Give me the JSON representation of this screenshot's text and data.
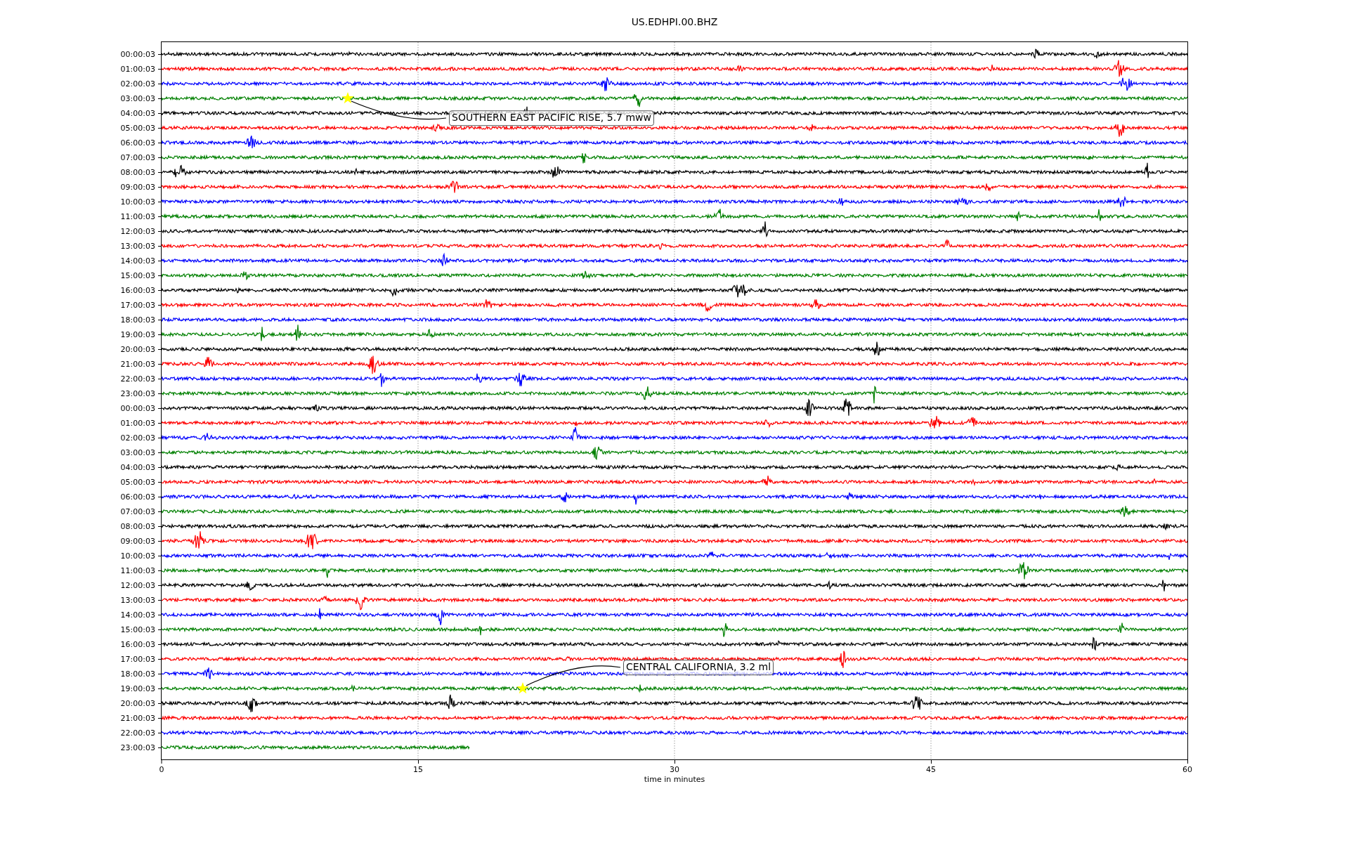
{
  "title": "US.EDHPI.00.BHZ",
  "traces": [
    {
      "label": "00:00:03",
      "color": "#000000",
      "level": 1
    },
    {
      "label": "01:00:03",
      "color": "#ff0000",
      "level": 1
    },
    {
      "label": "02:00:03",
      "color": "#0000ff",
      "level": 1
    },
    {
      "label": "03:00:03",
      "color": "#008000",
      "level": 1,
      "event": "SOUTHERN EAST PACIFIC RISE, 5.7 mww"
    },
    {
      "label": "04:00:03",
      "color": "#000000",
      "level": 1
    },
    {
      "label": "05:00:03",
      "color": "#ff0000",
      "level": 1
    },
    {
      "label": "06:00:03",
      "color": "#0000ff",
      "level": 1
    },
    {
      "label": "07:00:03",
      "color": "#008000",
      "level": 1
    },
    {
      "label": "08:00:03",
      "color": "#000000",
      "level": 1
    },
    {
      "label": "09:00:03",
      "color": "#ff0000",
      "level": 1
    },
    {
      "label": "10:00:03",
      "color": "#0000ff",
      "level": 1
    },
    {
      "label": "11:00:03",
      "color": "#008000",
      "level": 1
    },
    {
      "label": "12:00:03",
      "color": "#000000",
      "level": 1
    },
    {
      "label": "13:00:03",
      "color": "#ff0000",
      "level": 1
    },
    {
      "label": "14:00:03",
      "color": "#0000ff",
      "level": 1
    },
    {
      "label": "15:00:03",
      "color": "#008000",
      "level": 1
    },
    {
      "label": "16:00:03",
      "color": "#000000",
      "level": 1
    },
    {
      "label": "17:00:03",
      "color": "#ff0000",
      "level": 1
    },
    {
      "label": "18:00:03",
      "color": "#0000ff",
      "level": 1
    },
    {
      "label": "19:00:03",
      "color": "#008000",
      "level": 1
    },
    {
      "label": "20:00:03",
      "color": "#000000",
      "level": 1
    },
    {
      "label": "21:00:03",
      "color": "#ff0000",
      "level": 1
    },
    {
      "label": "22:00:03",
      "color": "#0000ff",
      "level": 1
    },
    {
      "label": "23:00:03",
      "color": "#008000",
      "level": 1
    },
    {
      "label": "00:00:03",
      "color": "#000000",
      "level": 1
    },
    {
      "label": "01:00:03",
      "color": "#ff0000",
      "level": 1
    },
    {
      "label": "02:00:03",
      "color": "#0000ff",
      "level": 1
    },
    {
      "label": "03:00:03",
      "color": "#008000",
      "level": 1
    },
    {
      "label": "04:00:03",
      "color": "#000000",
      "level": 1
    },
    {
      "label": "05:00:03",
      "color": "#ff0000",
      "level": 1
    },
    {
      "label": "06:00:03",
      "color": "#0000ff",
      "level": 1
    },
    {
      "label": "07:00:03",
      "color": "#008000",
      "level": 1
    },
    {
      "label": "08:00:03",
      "color": "#000000",
      "level": 1
    },
    {
      "label": "09:00:03",
      "color": "#ff0000",
      "level": 1
    },
    {
      "label": "10:00:03",
      "color": "#0000ff",
      "level": 1
    },
    {
      "label": "11:00:03",
      "color": "#008000",
      "level": 1
    },
    {
      "label": "12:00:03",
      "color": "#000000",
      "level": 1
    },
    {
      "label": "13:00:03",
      "color": "#ff0000",
      "level": 1
    },
    {
      "label": "14:00:03",
      "color": "#0000ff",
      "level": 1
    },
    {
      "label": "15:00:03",
      "color": "#008000",
      "level": 1
    },
    {
      "label": "16:00:03",
      "color": "#000000",
      "level": 1
    },
    {
      "label": "17:00:03",
      "color": "#ff0000",
      "level": 1
    },
    {
      "label": "18:00:03",
      "color": "#0000ff",
      "level": 1
    },
    {
      "label": "19:00:03",
      "color": "#008000",
      "level": 1,
      "event": "CENTRAL CALIFORNIA, 3.2 ml"
    },
    {
      "label": "20:00:03",
      "color": "#000000",
      "level": 1
    },
    {
      "label": "21:00:03",
      "color": "#ff0000",
      "level": 1
    },
    {
      "label": "22:00:03",
      "color": "#0000ff",
      "level": 1
    },
    {
      "label": "23:00:03",
      "color": "#008000",
      "level": 0.3
    }
  ],
  "xticks": [
    "0",
    "15",
    "30",
    "45",
    "60"
  ],
  "xlabel": "time in minutes"
}
